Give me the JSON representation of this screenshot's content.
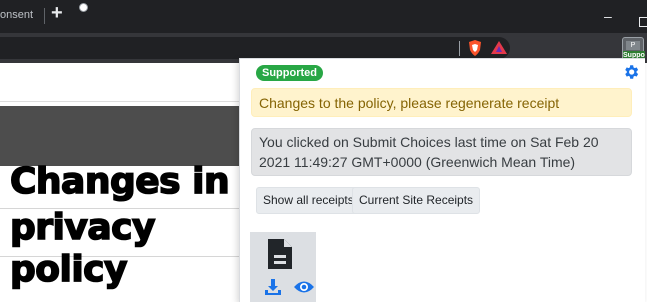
{
  "browser": {
    "tab_title": "onsent",
    "new_tab_glyph": "+",
    "minimize_glyph": "–",
    "extension_badge": "Suppo",
    "extension_icon_letter": "P"
  },
  "page": {
    "heading_lines": [
      "Changes in",
      "privacy",
      "policy"
    ]
  },
  "popup": {
    "status_badge": "Supported",
    "warning_text": "Changes to the policy, please regenerate receipt",
    "info_text": "You clicked on Submit Choices last time on Sat Feb 20 2021 11:49:27 GMT+0000 (Greenwich Mean Time)",
    "buttons": {
      "show_all": "Show all receipts",
      "current_site": "Current Site Receipts"
    },
    "icons": {
      "settings": "gear-icon",
      "receipt": "document-icon",
      "download": "download-icon",
      "view": "eye-icon"
    }
  },
  "colors": {
    "badge_green": "#28a745",
    "warning_bg": "#fff3cd",
    "warning_text": "#856404",
    "info_bg": "#e2e3e5",
    "accent_blue": "#1a73e8"
  }
}
